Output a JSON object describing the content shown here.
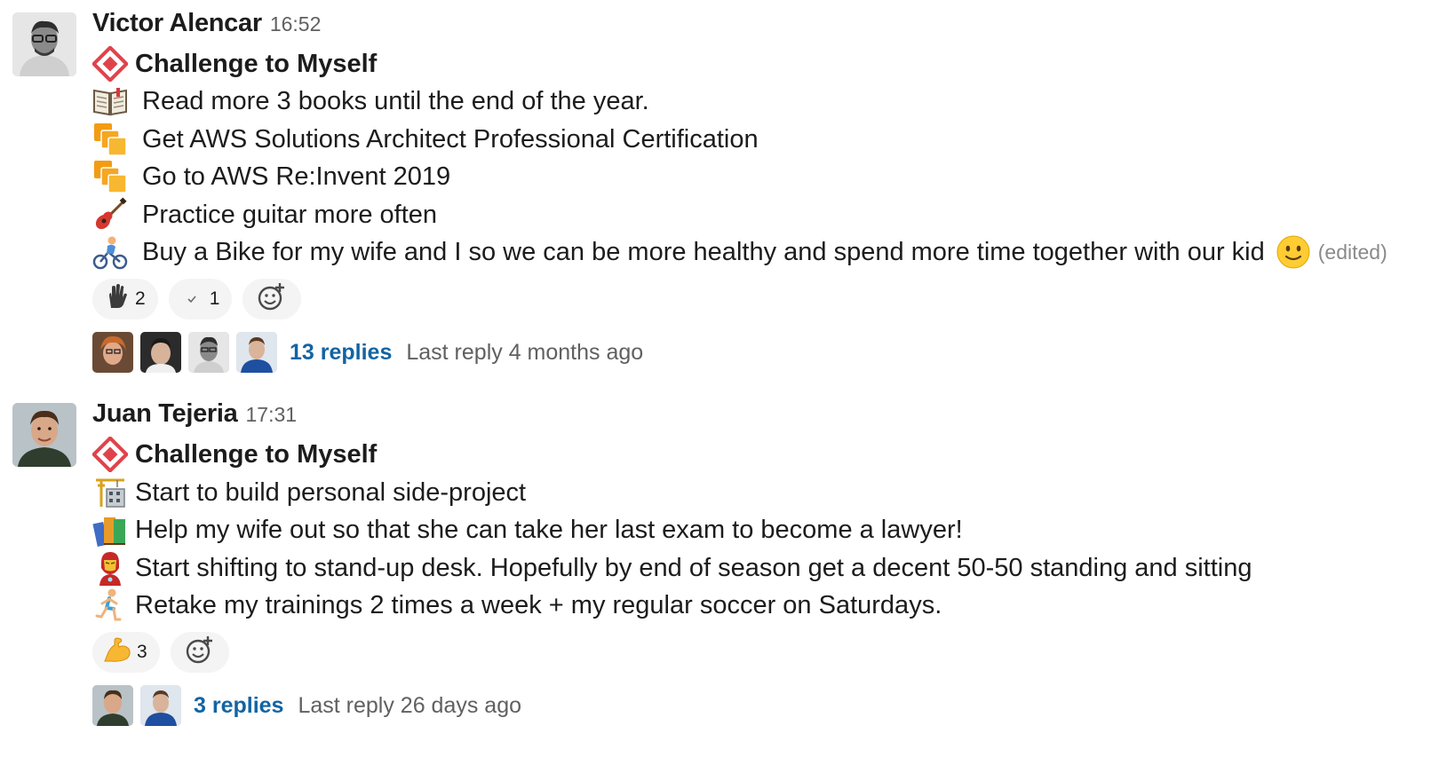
{
  "messages": [
    {
      "author": "Victor Alencar",
      "time": "16:52",
      "title": "Challenge to Myself",
      "title_icon": "red-diamond-icon",
      "items": [
        {
          "icon": "open-book-icon",
          "text": "Read more 3 books until the end of the year."
        },
        {
          "icon": "aws-stack-icon",
          "text": "Get AWS Solutions Architect Professional Certification"
        },
        {
          "icon": "aws-stack-icon",
          "text": "Go to AWS Re:Invent 2019"
        },
        {
          "icon": "guitar-icon",
          "text": "Practice guitar more often"
        },
        {
          "icon": "cyclist-icon",
          "text": "Buy a Bike for my wife and I so we can be more healthy and spend more time together with our kid",
          "trailing_icon": "slightly-smiling-face-icon",
          "edited": "(edited)"
        }
      ],
      "reactions": [
        {
          "icon": "raised-hand-icon",
          "count": "2"
        },
        {
          "icon": "check-mark-icon",
          "count": "1"
        }
      ],
      "thread": {
        "replies": "13 replies",
        "last_reply": "Last reply 4 months ago"
      }
    },
    {
      "author": "Juan Tejeria",
      "time": "17:31",
      "title": "Challenge to Myself",
      "title_icon": "red-diamond-icon",
      "items": [
        {
          "icon": "building-construction-icon",
          "text": "Start to build personal side-project"
        },
        {
          "icon": "books-icon",
          "text": "Help my wife out so that she can take her last exam to become a lawyer!"
        },
        {
          "icon": "iron-man-icon",
          "text": "Start shifting to stand-up desk. Hopefully by end of season get a decent 50-50 standing and sitting"
        },
        {
          "icon": "runner-icon",
          "text": "Retake my trainings 2 times a week + my regular soccer on Saturdays."
        }
      ],
      "reactions": [
        {
          "icon": "flexed-biceps-icon",
          "count": "3"
        }
      ],
      "thread": {
        "replies": "3 replies",
        "last_reply": "Last reply 26 days ago"
      }
    }
  ],
  "colors": {
    "link": "#1264a3",
    "muted": "#616061",
    "reaction_bg": "#f4f4f4"
  }
}
